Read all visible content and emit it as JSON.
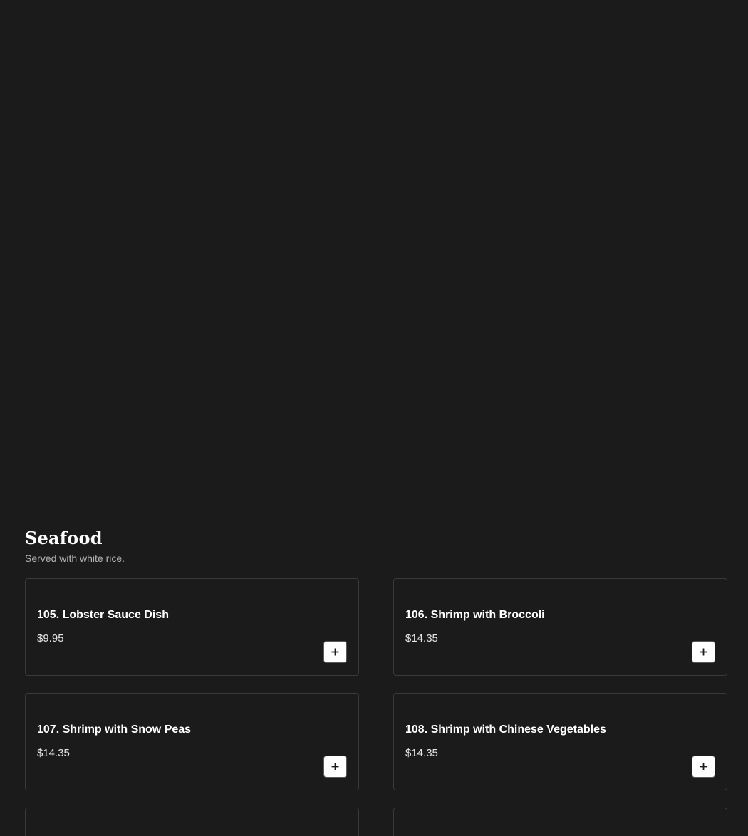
{
  "section": {
    "title": "Seafood",
    "description": "Served with white rice."
  },
  "items": [
    {
      "name": "105. Lobster Sauce Dish",
      "price": "$9.95",
      "add_icon": "plus-icon"
    },
    {
      "name": "106. Shrimp with Broccoli",
      "price": "$14.35",
      "add_icon": "plus-icon"
    },
    {
      "name": "107. Shrimp with Snow Peas",
      "price": "$14.35",
      "add_icon": "plus-icon"
    },
    {
      "name": "108. Shrimp with Chinese Vegetables",
      "price": "$14.35",
      "add_icon": "plus-icon"
    }
  ],
  "colors": {
    "background": "#1b1b1b",
    "card_border": "#3a3a3a",
    "text": "#ffffff",
    "muted_text": "#b3b3b3",
    "button_bg": "#ffffff"
  }
}
